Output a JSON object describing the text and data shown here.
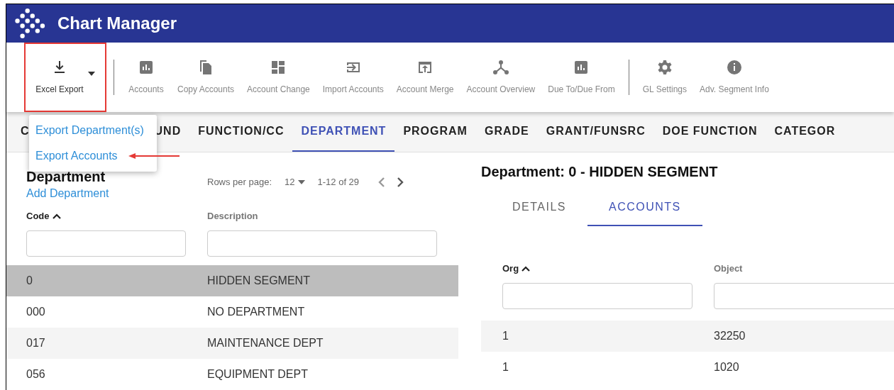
{
  "app": {
    "title": "Chart Manager"
  },
  "toolbar": [
    {
      "kind": "dropdown",
      "label": "Excel Export",
      "selected": true
    },
    {
      "kind": "divider"
    },
    {
      "kind": "button",
      "label": "Accounts"
    },
    {
      "kind": "button",
      "label": "Copy Accounts"
    },
    {
      "kind": "button",
      "label": "Account Change"
    },
    {
      "kind": "button",
      "label": "Import Accounts"
    },
    {
      "kind": "button",
      "label": "Account Merge"
    },
    {
      "kind": "button",
      "label": "Account Overview"
    },
    {
      "kind": "button",
      "label": "Due To/Due From"
    },
    {
      "kind": "divider"
    },
    {
      "kind": "button",
      "label": "GL Settings"
    },
    {
      "kind": "button",
      "label": "Adv. Segment Info"
    }
  ],
  "export_menu": {
    "items": [
      {
        "label": "Export Department(s)",
        "highlighted": false
      },
      {
        "label": "Export Accounts",
        "highlighted": true
      }
    ]
  },
  "segment_tabs": [
    {
      "label": "C",
      "selected": false
    },
    {
      "label": "UND",
      "selected": false
    },
    {
      "label": "FUNCTION/CC",
      "selected": false
    },
    {
      "label": "DEPARTMENT",
      "selected": true
    },
    {
      "label": "PROGRAM",
      "selected": false
    },
    {
      "label": "GRADE",
      "selected": false
    },
    {
      "label": "GRANT/FUNSRC",
      "selected": false
    },
    {
      "label": "DOE FUNCTION",
      "selected": false
    },
    {
      "label": "CATEGOR",
      "selected": false
    }
  ],
  "list": {
    "title": "Department",
    "add_link": "Add Department",
    "rows_per_page_label": "Rows per page:",
    "rows_per_page": "12",
    "range": "1-12 of 29",
    "columns": [
      {
        "label": "Code",
        "sorted": true
      },
      {
        "label": "Description",
        "sorted": false
      }
    ],
    "rows": [
      {
        "code": "0",
        "description": "HIDDEN SEGMENT",
        "selected": true
      },
      {
        "code": "000",
        "description": "NO DEPARTMENT",
        "selected": false
      },
      {
        "code": "017",
        "description": "MAINTENANCE DEPT",
        "selected": false
      },
      {
        "code": "056",
        "description": "EQUIPMENT DEPT",
        "selected": false
      }
    ]
  },
  "detail": {
    "title": "Department: 0 - HIDDEN SEGMENT",
    "tabs": [
      {
        "label": "DETAILS",
        "selected": false
      },
      {
        "label": "ACCOUNTS",
        "selected": true
      }
    ],
    "columns": [
      {
        "label": "Org",
        "sorted": true
      },
      {
        "label": "Object",
        "sorted": false
      }
    ],
    "rows": [
      {
        "org": "1",
        "object": "32250"
      },
      {
        "org": "1",
        "object": "1020"
      }
    ]
  }
}
